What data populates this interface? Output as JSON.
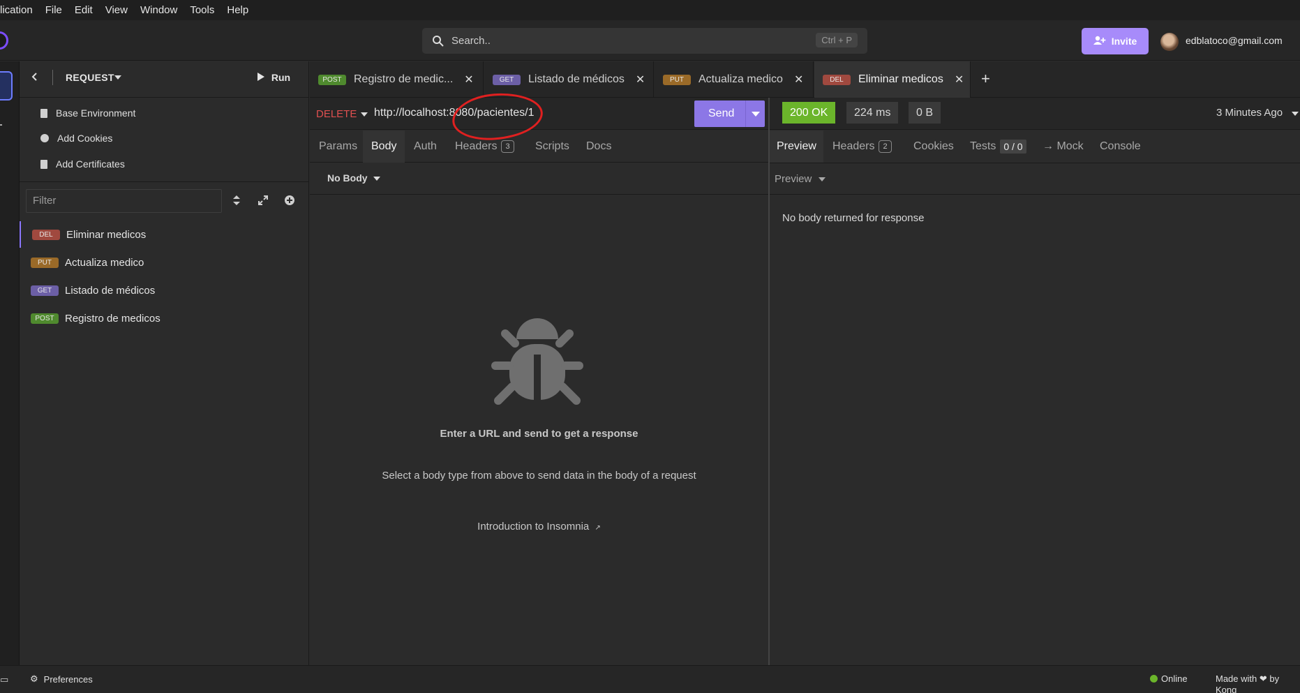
{
  "menu": [
    "lication",
    "File",
    "Edit",
    "View",
    "Window",
    "Tools",
    "Help"
  ],
  "search": {
    "placeholder": "Search..",
    "shortcut": "Ctrl + P"
  },
  "header": {
    "invite_label": "Invite",
    "email": "edblatoco@gmail.com"
  },
  "sidebar": {
    "title": "REQUEST",
    "run_label": "Run",
    "links": [
      "Base Environment",
      "Add Cookies",
      "Add Certificates"
    ],
    "filter_placeholder": "Filter",
    "requests": [
      {
        "method": "DEL",
        "name": "Eliminar medicos"
      },
      {
        "method": "PUT",
        "name": "Actualiza medico"
      },
      {
        "method": "GET",
        "name": "Listado de médicos"
      },
      {
        "method": "POST",
        "name": "Registro de medicos"
      }
    ]
  },
  "tabs": [
    {
      "method": "POST",
      "name": "Registro de medic..."
    },
    {
      "method": "GET",
      "name": "Listado de médicos"
    },
    {
      "method": "PUT",
      "name": "Actualiza medico"
    },
    {
      "method": "DEL",
      "name": "Eliminar medicos"
    }
  ],
  "request": {
    "method": "DELETE",
    "url": "http://localhost:8080/pacientes/1",
    "send_label": "Send",
    "subtabs": [
      "Params",
      "Body",
      "Auth",
      "Headers",
      "Scripts",
      "Docs"
    ],
    "headers_count": "3",
    "body_type": "No Body",
    "empty_title": "Enter a URL and send to get a response",
    "empty_sub": "Select a body type from above to send data in the body of a request",
    "intro_link": "Introduction to Insomnia"
  },
  "response": {
    "status": "200 OK",
    "time": "224 ms",
    "size": "0 B",
    "ago": "3 Minutes Ago",
    "subtabs": [
      "Preview",
      "Headers",
      "Cookies",
      "Tests",
      "→ Mock",
      "Console"
    ],
    "headers_count": "2",
    "tests": "0 / 0",
    "preview_label": "Preview",
    "empty": "No body returned for response"
  },
  "statusbar": {
    "preferences": "Preferences",
    "online": "Online",
    "made_with": "Made with ❤ by Kong"
  },
  "colors": {
    "accent": "#8c77e6",
    "invite": "#a78bfa",
    "delete": "#e05050",
    "ok": "#6bb52b",
    "annotation": "#e02020"
  }
}
